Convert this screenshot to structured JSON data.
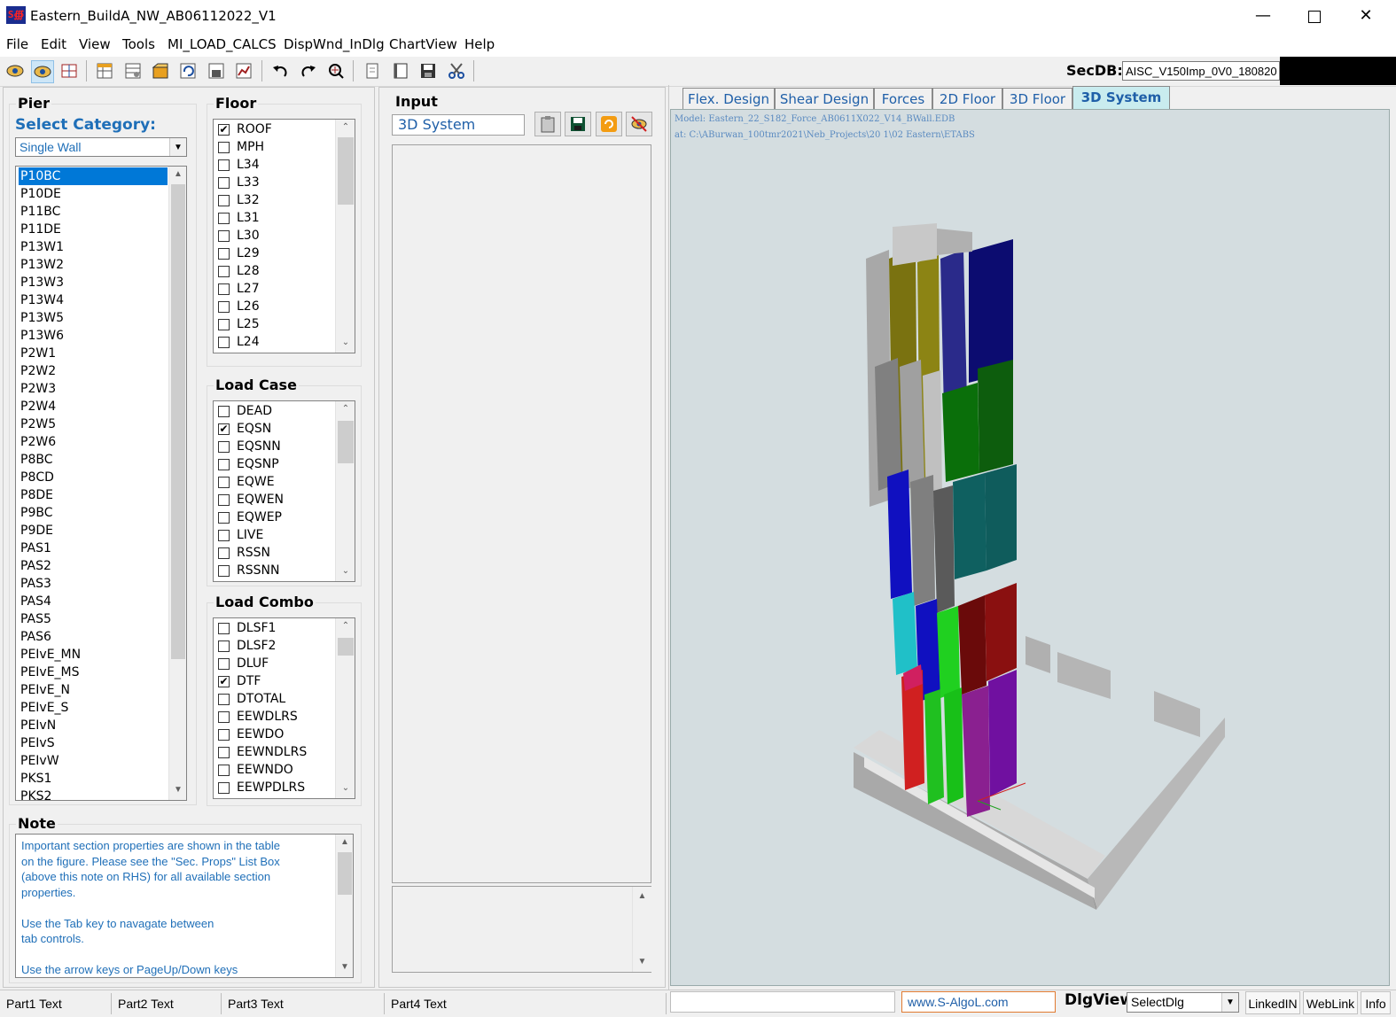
{
  "window": {
    "title": "Eastern_BuildA_NW_AB06112022_V1",
    "app_icon_text": "S∰"
  },
  "menu": [
    "File",
    "Edit",
    "View",
    "Tools",
    "MI_LOAD_CALCS",
    "DispWnd_InDlg",
    "ChartView",
    "Help"
  ],
  "toolbar": {
    "secdb_label": "SecDB:",
    "secdb_value": "AISC_V150Imp_0V0_180820"
  },
  "pier": {
    "title": "Pier",
    "select_category_label": "Select Category:",
    "category_value": "Single Wall",
    "items": [
      "P10BC",
      "P10DE",
      "P11BC",
      "P11DE",
      "P13W1",
      "P13W2",
      "P13W3",
      "P13W4",
      "P13W5",
      "P13W6",
      "P2W1",
      "P2W2",
      "P2W3",
      "P2W4",
      "P2W5",
      "P2W6",
      "P8BC",
      "P8CD",
      "P8DE",
      "P9BC",
      "P9DE",
      "PAS1",
      "PAS2",
      "PAS3",
      "PAS4",
      "PAS5",
      "PAS6",
      "PEIvE_MN",
      "PEIvE_MS",
      "PEIvE_N",
      "PEIvE_S",
      "PEIvN",
      "PEIvS",
      "PEIvW",
      "PKS1",
      "PKS2"
    ],
    "selected_index": 0
  },
  "floor": {
    "title": "Floor",
    "items": [
      {
        "label": "ROOF",
        "checked": true
      },
      {
        "label": "MPH",
        "checked": false
      },
      {
        "label": "L34",
        "checked": false
      },
      {
        "label": "L33",
        "checked": false
      },
      {
        "label": "L32",
        "checked": false
      },
      {
        "label": "L31",
        "checked": false
      },
      {
        "label": "L30",
        "checked": false
      },
      {
        "label": "L29",
        "checked": false
      },
      {
        "label": "L28",
        "checked": false
      },
      {
        "label": "L27",
        "checked": false
      },
      {
        "label": "L26",
        "checked": false
      },
      {
        "label": "L25",
        "checked": false
      },
      {
        "label": "L24",
        "checked": false
      }
    ]
  },
  "load_case": {
    "title": "Load Case",
    "items": [
      {
        "label": "DEAD",
        "checked": false
      },
      {
        "label": "EQSN",
        "checked": true
      },
      {
        "label": "EQSNN",
        "checked": false
      },
      {
        "label": "EQSNP",
        "checked": false
      },
      {
        "label": "EQWE",
        "checked": false
      },
      {
        "label": "EQWEN",
        "checked": false
      },
      {
        "label": "EQWEP",
        "checked": false
      },
      {
        "label": "LIVE",
        "checked": false
      },
      {
        "label": "RSSN",
        "checked": false
      },
      {
        "label": "RSSNN",
        "checked": false
      }
    ]
  },
  "load_combo": {
    "title": "Load Combo",
    "items": [
      {
        "label": "DLSF1",
        "checked": false
      },
      {
        "label": "DLSF2",
        "checked": false
      },
      {
        "label": "DLUF",
        "checked": false
      },
      {
        "label": "DTF",
        "checked": true
      },
      {
        "label": "DTOTAL",
        "checked": false
      },
      {
        "label": "EEWDLRS",
        "checked": false
      },
      {
        "label": "EEWDO",
        "checked": false
      },
      {
        "label": "EEWNDLRS",
        "checked": false
      },
      {
        "label": "EEWNDO",
        "checked": false
      },
      {
        "label": "EEWPDLRS",
        "checked": false
      }
    ]
  },
  "note": {
    "title": "Note",
    "lines": [
      "Important section properties are shown in the table",
      "on the figure. Please see the \"Sec. Props\" List Box",
      "(above this note on RHS) for all available section",
      "properties.",
      "",
      "Use the Tab key to navagate between",
      "tab controls.",
      "",
      "Use the arrow keys or PageUp/Down keys"
    ]
  },
  "input": {
    "title": "Input",
    "value": "3D System"
  },
  "tabs": [
    {
      "label": "Flex. Design",
      "active": false
    },
    {
      "label": "Shear Design",
      "active": false
    },
    {
      "label": "Forces",
      "active": false
    },
    {
      "label": "2D Floor",
      "active": false
    },
    {
      "label": "3D Floor",
      "active": false
    },
    {
      "label": "3D System",
      "active": true
    }
  ],
  "view3d": {
    "model_line": "Model: Eastern_22_S182_Force_AB0611X022_V14_BWall.EDB",
    "path_line": "at: C:\\ABurwan_100tmr2021\\Neb_Projects\\20 1\\02 Eastern\\ETABS"
  },
  "status": {
    "parts": [
      "Part1 Text",
      "Part2 Text",
      "Part3 Text",
      "Part4 Text"
    ],
    "website": "www.S-AlgoL.com",
    "dlgview_label": "DlgView",
    "dlgview_value": "SelectDlg",
    "buttons": [
      "LinkedIN",
      "WebLink",
      "Info"
    ]
  }
}
